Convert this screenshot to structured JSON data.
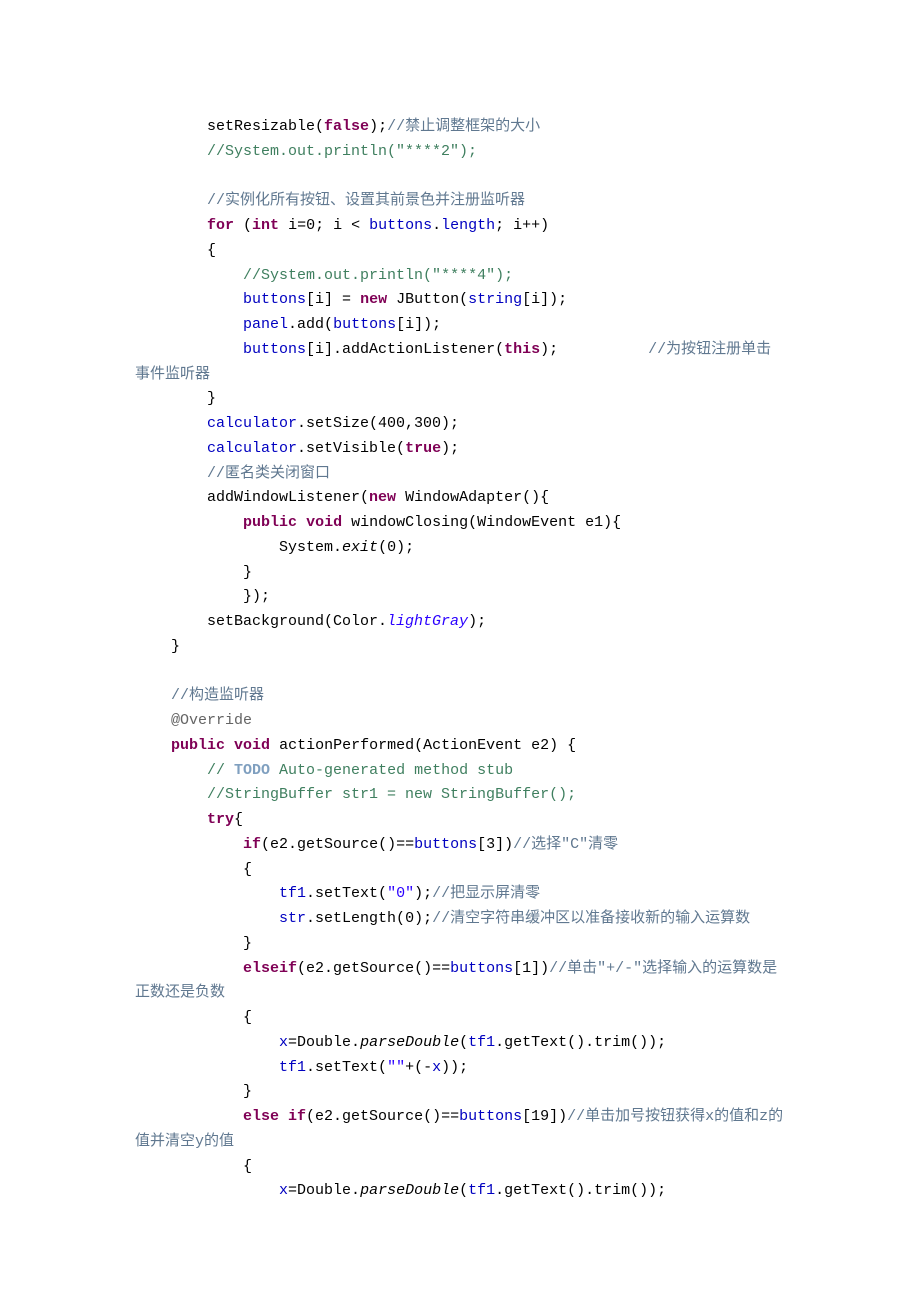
{
  "lines": {
    "l1_a": "        setResizable(",
    "l1_b": "false",
    "l1_c": ");",
    "l1_d": "//禁止调整框架的大小",
    "l2": "        //System.out.println(\"****2\");",
    "l3": "",
    "l4": "        //实例化所有按钮、设置其前景色并注册监听器",
    "l5_a": "        ",
    "l5_b": "for",
    "l5_c": " (",
    "l5_d": "int",
    "l5_e": " i=0; i < ",
    "l5_f": "buttons",
    "l5_g": ".",
    "l5_h": "length",
    "l5_i": "; i++)",
    "l6": "        {",
    "l7": "            //System.out.println(\"****4\");",
    "l8_a": "            ",
    "l8_b": "buttons",
    "l8_c": "[i] = ",
    "l8_d": "new",
    "l8_e": " JButton(",
    "l8_f": "string",
    "l8_g": "[i]);",
    "l9_a": "            ",
    "l9_b": "panel",
    "l9_c": ".add(",
    "l9_d": "buttons",
    "l9_e": "[i]);",
    "l10_a": "            ",
    "l10_b": "buttons",
    "l10_c": "[i].addActionListener(",
    "l10_d": "this",
    "l10_e": ");          ",
    "l10_f": "//为按钮注册单击事件监听器",
    "l11": "        }",
    "l12_a": "        ",
    "l12_b": "calculator",
    "l12_c": ".setSize(400,300);",
    "l13_a": "        ",
    "l13_b": "calculator",
    "l13_c": ".setVisible(",
    "l13_d": "true",
    "l13_e": ");",
    "l14": "        //匿名类关闭窗口",
    "l15_a": "        addWindowListener(",
    "l15_b": "new",
    "l15_c": " WindowAdapter(){",
    "l16_a": "            ",
    "l16_b": "public",
    "l16_c": " ",
    "l16_d": "void",
    "l16_e": " windowClosing(WindowEvent e1){",
    "l17_a": "                System.",
    "l17_b": "exit",
    "l17_c": "(0);",
    "l18": "            }",
    "l19": "            });",
    "l20_a": "        setBackground(Color.",
    "l20_b": "lightGray",
    "l20_c": ");",
    "l21": "    }",
    "l22": "",
    "l23": "    //构造监听器",
    "l24": "    @Override",
    "l25_a": "    ",
    "l25_b": "public",
    "l25_c": " ",
    "l25_d": "void",
    "l25_e": " actionPerformed(ActionEvent e2) {",
    "l26_a": "        // ",
    "l26_b": "TODO",
    "l26_c": " Auto-generated method stub",
    "l27": "        //StringBuffer str1 = new StringBuffer();",
    "l28_a": "        ",
    "l28_b": "try",
    "l28_c": "{",
    "l29_a": "            ",
    "l29_b": "if",
    "l29_c": "(e2.getSource()==",
    "l29_d": "buttons",
    "l29_e": "[3])",
    "l29_f": "//选择\"C\"清零",
    "l30": "            {",
    "l31_a": "                ",
    "l31_b": "tf1",
    "l31_c": ".setText(",
    "l31_d": "\"0\"",
    "l31_e": ");",
    "l31_f": "//把显示屏清零",
    "l32_a": "                ",
    "l32_b": "str",
    "l32_c": ".setLength(0);",
    "l32_d": "//清空字符串缓冲区以准备接收新的输入运算数",
    "l33": "            }",
    "l34_a": "            ",
    "l34_b": "elseif",
    "l34_c": "(e2.getSource()==",
    "l34_d": "buttons",
    "l34_e": "[1])",
    "l34_f": "//单击\"+/-\"选择输入的运算数是正数还是负数",
    "l35": "            {",
    "l36_a": "                ",
    "l36_b": "x",
    "l36_c": "=Double.",
    "l36_d": "parseDouble",
    "l36_e": "(",
    "l36_f": "tf1",
    "l36_g": ".getText().trim());",
    "l37_a": "                ",
    "l37_b": "tf1",
    "l37_c": ".setText(",
    "l37_d": "\"\"",
    "l37_e": "+(-",
    "l37_f": "x",
    "l37_g": "));",
    "l38": "            }",
    "l39_a": "            ",
    "l39_b": "else if",
    "l39_c": "(e2.getSource()==",
    "l39_d": "buttons",
    "l39_e": "[19])",
    "l39_f": "//单击加号按钮获得x的值和z的值并清空y的值",
    "l40": "            {",
    "l41_a": "                ",
    "l41_b": "x",
    "l41_c": "=Double.",
    "l41_d": "parseDouble",
    "l41_e": "(",
    "l41_f": "tf1",
    "l41_g": ".getText().trim());"
  }
}
